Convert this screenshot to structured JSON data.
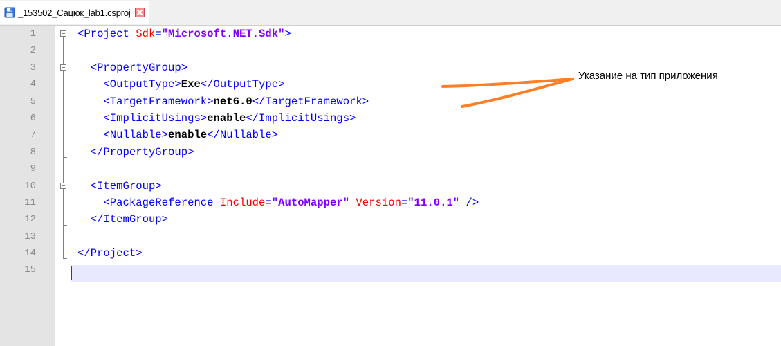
{
  "tab": {
    "label": "_153502_Сацюк_lab1.csproj",
    "save_icon": "floppy-disk-icon",
    "close_icon": "close-icon",
    "close_color": "#ff7777"
  },
  "editor": {
    "line_numbers": [
      "1",
      "2",
      "3",
      "4",
      "5",
      "6",
      "7",
      "8",
      "9",
      "10",
      "11",
      "12",
      "13",
      "14",
      "15"
    ],
    "current_line": "15",
    "lines": {
      "l1": {
        "open": "<Project ",
        "attr1": "Sdk",
        "eq1": "=",
        "val1": "\"Microsoft.NET.Sdk\"",
        "close": ">"
      },
      "l3": {
        "indent": "  ",
        "open": "<PropertyGroup>"
      },
      "l4": {
        "indent": "    ",
        "open": "<OutputType>",
        "text": "Exe",
        "close": "</OutputType>"
      },
      "l5": {
        "indent": "    ",
        "open": "<TargetFramework>",
        "text": "net6.0",
        "close": "</TargetFramework>"
      },
      "l6": {
        "indent": "    ",
        "open": "<ImplicitUsings>",
        "text": "enable",
        "close": "</ImplicitUsings>"
      },
      "l7": {
        "indent": "    ",
        "open": "<Nullable>",
        "text": "enable",
        "close": "</Nullable>"
      },
      "l8": {
        "indent": "  ",
        "open": "</PropertyGroup>"
      },
      "l10": {
        "indent": "  ",
        "open": "<ItemGroup>"
      },
      "l11": {
        "indent": "    ",
        "open": "<PackageReference ",
        "attr1": "Include",
        "eq1": "=",
        "val1": "\"AutoMapper\"",
        "sp": " ",
        "attr2": "Version",
        "eq2": "=",
        "val2": "\"11.0.1\"",
        "close": " />"
      },
      "l12": {
        "indent": "  ",
        "open": "</ItemGroup>"
      },
      "l14": {
        "open": "</Project>"
      }
    }
  },
  "annotation": {
    "text": "Указание на тип приложения",
    "arrow_color": "#ff7f27"
  },
  "colors": {
    "tag": "#0000ff",
    "attribute": "#ff0000",
    "attribute_value": "#8000ff",
    "text_content": "#000000",
    "gutter_bg": "#e4e4e4",
    "current_line_bg": "#e8e8ff"
  }
}
